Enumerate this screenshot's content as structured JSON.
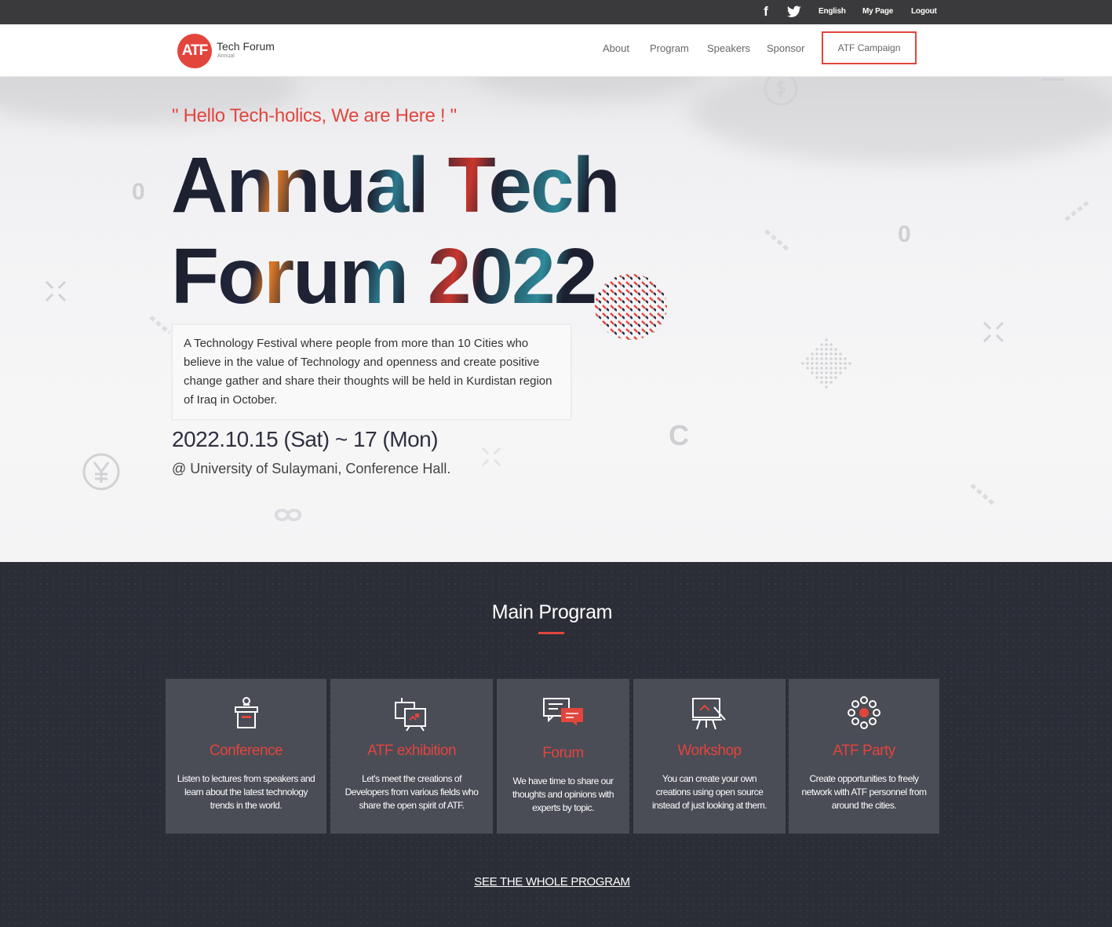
{
  "topbar": {
    "icons": [
      "facebook-icon",
      "twitter-icon"
    ],
    "facebook_glyph": "f",
    "links": [
      "English",
      "My Page",
      "Logout"
    ]
  },
  "header": {
    "logo_text": "ATF",
    "brand_name": "Tech Forum",
    "brand_sub": "Annual",
    "nav": [
      "About",
      "Program",
      "Speakers",
      "Sponsor"
    ],
    "cta": "ATF Campaign"
  },
  "hero": {
    "tagline": "\" Hello Tech-holics, We are Here ! \"",
    "title_line1": "Annual Tech",
    "title_line2": "Forum 2022",
    "description": "A Technology Festival where people from more than 10 Cities who believe in the value of Technology and openness and create positive change gather and share their thoughts will be held in Kurdistan region of Iraq in October.",
    "dates": "2022.10.15 (Sat) ~ 17 (Mon)",
    "venue": "@ University of Sulaymani, Conference Hall."
  },
  "program": {
    "title": "Main Program",
    "cards": [
      {
        "icon": "podium-icon",
        "title": "Conference",
        "description": "Listen to lectures from speakers and learn about the latest technology trends in the world."
      },
      {
        "icon": "exhibition-icon",
        "title": "ATF exhibition",
        "description": "Let's meet the creations of Developers from various fields who share the open spirit of ATF."
      },
      {
        "icon": "chat-bubbles-icon",
        "title": "Forum",
        "description": "We have time to share our thoughts and opinions with experts by topic."
      },
      {
        "icon": "presentation-board-icon",
        "title": "Workshop",
        "description": "You can create your own creations using open source instead of just looking at them."
      },
      {
        "icon": "party-icon",
        "title": "ATF Party",
        "description": "Create opportunities to freely network with ATF personnel from around the cities."
      }
    ],
    "see_all": "SEE THE WHOLE PROGRAM"
  },
  "colors": {
    "accent": "#e2453c",
    "topbar": "#3a3a3c",
    "section_dark": "#2b2d37",
    "card": "#4a4c56"
  }
}
